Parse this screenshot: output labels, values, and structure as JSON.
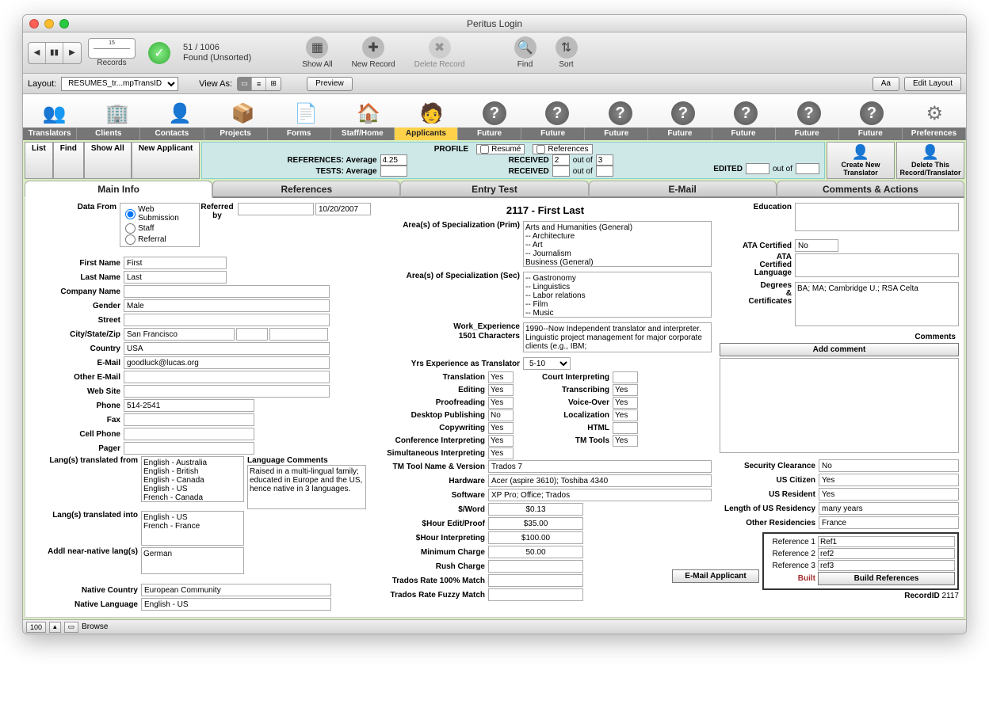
{
  "window": {
    "title": "Peritus Login"
  },
  "records": {
    "current": "15",
    "found": "51 / 1006",
    "state": "Found (Unsorted)",
    "label": "Records"
  },
  "tbuttons": {
    "showall": "Show All",
    "newrec": "New Record",
    "delrec": "Delete Record",
    "find": "Find",
    "sort": "Sort"
  },
  "layout": {
    "label": "Layout:",
    "value": "RESUMES_tr...mpTransID",
    "viewas": "View As:",
    "preview": "Preview",
    "edit": "Edit Layout",
    "aa": "Aa"
  },
  "icontabs": {
    "items": [
      "Translators",
      "Clients",
      "Contacts",
      "Projects",
      "Forms",
      "Staff/Home",
      "Applicants",
      "Future",
      "Future",
      "Future",
      "Future",
      "Future",
      "Future",
      "Future",
      "Preferences"
    ],
    "active": 6
  },
  "subbtns": {
    "list": "List",
    "find": "Find",
    "showall": "Show All",
    "newapp": "New Applicant"
  },
  "profile": {
    "title": "PROFILE",
    "resume": "Resumé",
    "references": "References",
    "refs_label": "REFERENCES: Average",
    "refs_avg": "4.25",
    "received1_l": "RECEIVED",
    "received1_a": "2",
    "outof": "out of",
    "received1_b": "3",
    "tests_label": "TESTS: Average",
    "tests_avg": "",
    "received2_l": "RECEIVED",
    "received2_a": "",
    "received2_b": "",
    "edited_l": "EDITED",
    "edited_a": "",
    "edited_b": ""
  },
  "actions": {
    "create": "Create New\nTranslator",
    "delete": "Delete This\nRecord/Translator"
  },
  "maintabs": {
    "items": [
      "Main Info",
      "References",
      "Entry Test",
      "E-Mail",
      "Comments & Actions"
    ],
    "active": 0
  },
  "main": {
    "header": "2117 - First Last",
    "datafrom_l": "Data From",
    "datafrom_opts": [
      "Web Submission",
      "Staff",
      "Referral"
    ],
    "datafrom_sel": 0,
    "refby_l": "Referred\nby",
    "refby_v": "",
    "refdate": "10/20/2007",
    "firstname_l": "First Name",
    "firstname": "First",
    "lastname_l": "Last Name",
    "lastname": "Last",
    "company_l": "Company Name",
    "company": "",
    "gender_l": "Gender",
    "gender": "Male",
    "street_l": "Street",
    "street": "",
    "csz_l": "City/State/Zip",
    "city": "San Francisco",
    "state": "",
    "zip": "",
    "country_l": "Country",
    "country": "USA",
    "email_l": "E-Mail",
    "email": "goodluck@lucas.org",
    "oemail_l": "Other E-Mail",
    "oemail": "",
    "website_l": "Web Site",
    "website": "",
    "phone_l": "Phone",
    "phone": "514-2541",
    "fax_l": "Fax",
    "fax": "",
    "cell_l": "Cell Phone",
    "cell": "",
    "pager_l": "Pager",
    "pager": "",
    "langfrom_l": "Lang(s) translated from",
    "langfrom": "English - Australia\nEnglish - British\nEnglish - Canada\nEnglish - US\nFrench - Canada",
    "langto_l": "Lang(s) translated into",
    "langto": "English - US\nFrench - France",
    "addl_l": "Addl near-native lang(s)",
    "addl": "German",
    "ncountry_l": "Native Country",
    "ncountry": "European Community",
    "nlang_l": "Native Language",
    "nlang": "English - US",
    "langcom_l": "Language Comments",
    "langcom": "Raised in a multi-lingual family; educated in Europe and the US, hence native in 3 languages."
  },
  "mid": {
    "spec_prim_l": "Area(s) of Specialization (Prim)",
    "spec_prim": "Arts and Humanities (General)\n-- Architecture\n-- Art\n-- Journalism\nBusiness (General)",
    "spec_sec_l": "Area(s) of Specialization (Sec)",
    "spec_sec": "-- Gastronomy\n-- Linguistics\n-- Labor relations\n-- Film\n-- Music",
    "workexp_l": "Work_Experience\n1501 Characters",
    "workexp": "1990--Now   Independent translator and interpreter. Linguistic project management for major corporate clients (e.g., IBM;",
    "yrs_l": "Yrs Experience as Translator",
    "yrs": "5-10",
    "skills": {
      "translation_l": "Translation",
      "translation": "Yes",
      "editing_l": "Editing",
      "editing": "Yes",
      "proof_l": "Proofreading",
      "proof": "Yes",
      "dtp_l": "Desktop Publishing",
      "dtp": "No",
      "copy_l": "Copywriting",
      "copy": "Yes",
      "confint_l": "Conference Interpreting",
      "confint": "Yes",
      "simint_l": "Simultaneous Interpreting",
      "simint": "Yes",
      "court_l": "Court Interpreting",
      "court": "",
      "trans_l": "Transcribing",
      "trans": "Yes",
      "voice_l": "Voice-Over",
      "voice": "Yes",
      "loc_l": "Localization",
      "loc": "Yes",
      "html_l": "HTML",
      "html": "",
      "tmtools_l": "TM Tools",
      "tmtools": "Yes"
    },
    "tmname_l": "TM Tool Name & Version",
    "tmname": "Trados 7",
    "hw_l": "Hardware",
    "hw": "Acer (aspire 3610); Toshiba 4340",
    "sw_l": "Software",
    "sw": "XP Pro; Office; Trados",
    "word_l": "$/Word",
    "word": "$0.13",
    "hredit_l": "$Hour Edit/Proof",
    "hredit": "$35.00",
    "hrint_l": "$Hour Interpreting",
    "hrint": "$100.00",
    "mincharge_l": "Minimum Charge",
    "mincharge": "50.00",
    "rush_l": "Rush Charge",
    "rush": "",
    "tr100_l": "Trados Rate 100% Match",
    "tr100": "",
    "trfuz_l": "Trados Rate Fuzzy Match",
    "trfuz": ""
  },
  "right": {
    "edu_l": "Education",
    "edu": "",
    "ata_l": "ATA Certified",
    "ata": "No",
    "atalang_l": "ATA\nCertified\nLanguage",
    "atalang": "",
    "deg_l": "Degrees\n&\nCertificates",
    "deg": "BA; MA; Cambridge U.; RSA Celta",
    "comments_l": "Comments",
    "addcomment": "Add comment",
    "sec_l": "Security Clearance",
    "sec": "No",
    "usc_l": "US Citizen",
    "usc": "Yes",
    "usr_l": "US Resident",
    "usr": "Yes",
    "lenres_l": "Length of US Residency",
    "lenres": "many years",
    "othres_l": "Other Residencies",
    "othres": "France",
    "emailapp": "E-Mail Applicant",
    "ref1_l": "Reference 1",
    "ref1": "Ref1",
    "ref2_l": "Reference 2",
    "ref2": "ref2",
    "ref3_l": "Reference 3",
    "ref3": "ref3",
    "built": "Built",
    "buildrefs": "Build References",
    "recordid_l": "RecordID",
    "recordid": "2117"
  },
  "status": {
    "zoom": "100",
    "mode": "Browse"
  }
}
